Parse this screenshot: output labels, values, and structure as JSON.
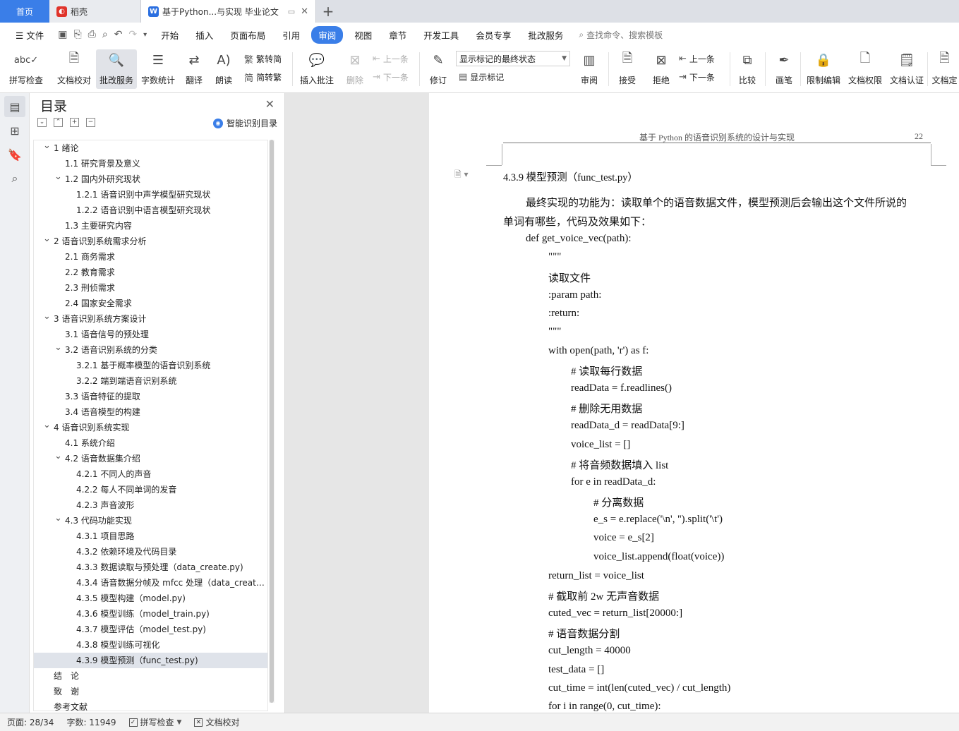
{
  "tabs": {
    "home": "首页",
    "wps": "稻壳",
    "doc": "基于Python...与实现 毕业论文"
  },
  "menu": {
    "file": "文件",
    "items": [
      "开始",
      "插入",
      "页面布局",
      "引用",
      "审阅",
      "视图",
      "章节",
      "开发工具",
      "会员专享",
      "批改服务"
    ],
    "active": "审阅",
    "search": "查找命令、搜索模板"
  },
  "ribbon": {
    "spell": "拼写检查",
    "proof": "文档校对",
    "correct": "批改服务",
    "wordcount": "字数统计",
    "translate": "翻译",
    "read": "朗读",
    "to_trad": "繁转简",
    "to_simp": "简转繁",
    "insert_comment": "插入批注",
    "delete": "删除",
    "prev": "上一条",
    "next": "下一条",
    "track": "修订",
    "markup_state": "显示标记的最终状态",
    "show_markup": "显示标记",
    "review": "审阅",
    "accept": "接受",
    "reject": "拒绝",
    "prev2": "上一条",
    "next2": "下一条",
    "compare": "比较",
    "pen": "画笔",
    "restrict": "限制编辑",
    "rights": "文档权限",
    "certify": "文档认证",
    "finalize": "文档定"
  },
  "toc": {
    "title": "目录",
    "smart": "智能识别目录",
    "items": [
      {
        "level": 1,
        "text": "1 绪论",
        "expand": true
      },
      {
        "level": 2,
        "text": "1.1 研究背景及意义"
      },
      {
        "level": 2,
        "text": "1.2 国内外研究现状",
        "expand": true
      },
      {
        "level": 3,
        "text": "1.2.1 语音识别中声学模型研究现状"
      },
      {
        "level": 3,
        "text": "1.2.2 语音识别中语言模型研究现状"
      },
      {
        "level": 2,
        "text": "1.3 主要研究内容"
      },
      {
        "level": 1,
        "text": "2 语音识别系统需求分析",
        "expand": true
      },
      {
        "level": 2,
        "text": "2.1 商务需求"
      },
      {
        "level": 2,
        "text": "2.2 教育需求"
      },
      {
        "level": 2,
        "text": "2.3 刑侦需求"
      },
      {
        "level": 2,
        "text": "2.4 国家安全需求"
      },
      {
        "level": 1,
        "text": "3 语音识别系统方案设计",
        "expand": true
      },
      {
        "level": 2,
        "text": "3.1 语音信号的预处理"
      },
      {
        "level": 2,
        "text": "3.2 语音识别系统的分类",
        "expand": true
      },
      {
        "level": 3,
        "text": "3.2.1 基于概率模型的语音识别系统"
      },
      {
        "level": 3,
        "text": "3.2.2 端到端语音识别系统"
      },
      {
        "level": 2,
        "text": "3.3 语音特征的提取"
      },
      {
        "level": 2,
        "text": "3.4 语音模型的构建"
      },
      {
        "level": 1,
        "text": "4 语音识别系统实现",
        "expand": true
      },
      {
        "level": 2,
        "text": "4.1 系统介绍"
      },
      {
        "level": 2,
        "text": "4.2 语音数据集介绍",
        "expand": true
      },
      {
        "level": 3,
        "text": "4.2.1 不同人的声音"
      },
      {
        "level": 3,
        "text": "4.2.2 每人不同单词的发音"
      },
      {
        "level": 3,
        "text": "4.2.3 声音波形"
      },
      {
        "level": 2,
        "text": "4.3 代码功能实现",
        "expand": true
      },
      {
        "level": 3,
        "text": "4.3.1 项目思路"
      },
      {
        "level": 3,
        "text": "4.3.2 依赖环境及代码目录"
      },
      {
        "level": 3,
        "text": "4.3.3 数据读取与预处理（data_create.py)"
      },
      {
        "level": 3,
        "text": "4.3.4 语音数据分帧及 mfcc 处理（data_create ..."
      },
      {
        "level": 3,
        "text": "4.3.5 模型构建（model.py)"
      },
      {
        "level": 3,
        "text": "4.3.6 模型训练（model_train.py)"
      },
      {
        "level": 3,
        "text": "4.3.7 模型评估（model_test.py)"
      },
      {
        "level": 3,
        "text": "4.3.8 模型训练可视化"
      },
      {
        "level": 3,
        "text": "4.3.9 模型预测（func_test.py)",
        "selected": true
      },
      {
        "level": 0,
        "text": "结　论"
      },
      {
        "level": 0,
        "text": "致　谢"
      },
      {
        "level": 0,
        "text": "参考文献"
      }
    ]
  },
  "page": {
    "header": "基于 Python 的语音识别系统的设计与实现",
    "number": "22",
    "heading": "4.3.9  模型预测（func_test.py）",
    "para1": "最终实现的功能为：读取单个的语音数据文件，模型预测后会输出这个文件所说的",
    "para2": "单词有哪些，代码及效果如下：",
    "code": [
      "def get_voice_vec(path):",
      "\"\"\"",
      "读取文件",
      ":param path:",
      ":return:",
      "\"\"\"",
      "with open(path, 'r') as f:",
      "#  读取每行数据",
      "readData = f.readlines()",
      "#  删除无用数据",
      "readData_d = readData[9:]",
      "voice_list = []",
      "#  将音频数据填入 list",
      "for e in readData_d:",
      "#  分离数据",
      "e_s = e.replace('\\n', '').split('\\t')",
      "voice = e_s[2]",
      "voice_list.append(float(voice))",
      "return_list = voice_list",
      "#  截取前 2w 无声音数据",
      "cuted_vec = return_list[20000:]",
      "#  语音数据分割",
      "cut_length = 40000",
      "test_data = []",
      "cut_time = int(len(cuted_vec) / cut_length)",
      "for i in range(0, cut_time):"
    ]
  },
  "status": {
    "page": "页面: 28/34",
    "words": "字数: 11949",
    "spell": "拼写检查",
    "proof": "文档校对"
  }
}
